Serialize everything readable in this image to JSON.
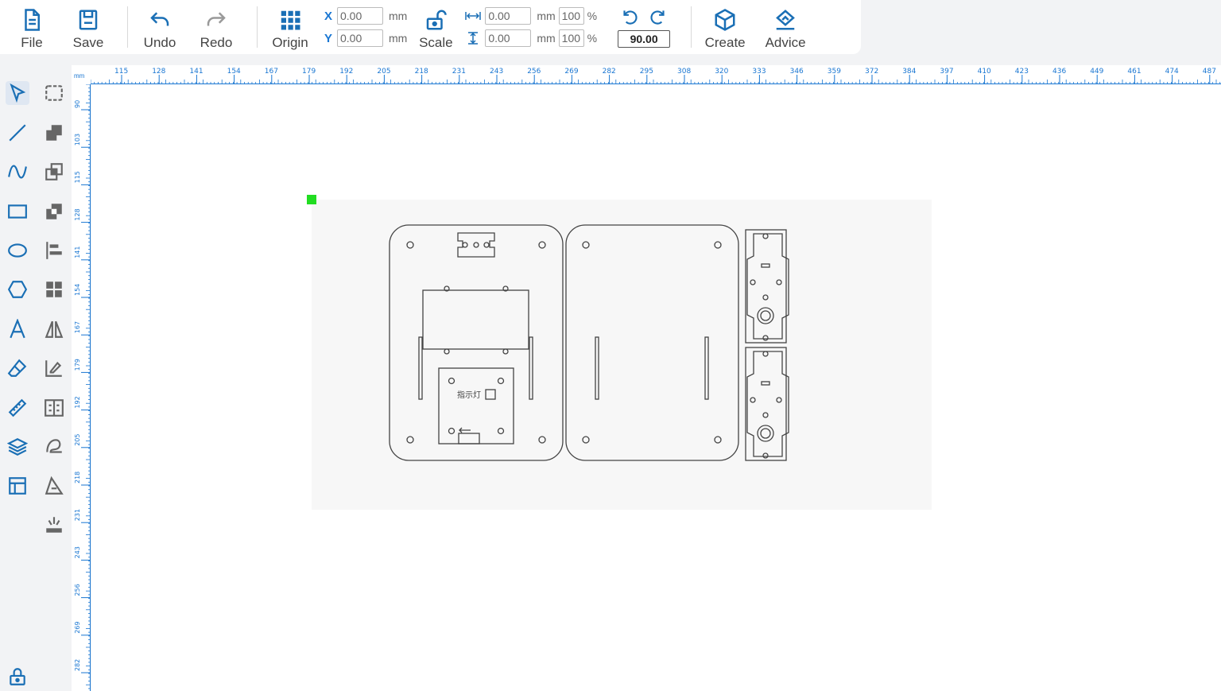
{
  "toolbar": {
    "file_label": "File",
    "save_label": "Save",
    "undo_label": "Undo",
    "redo_label": "Redo",
    "origin_label": "Origin",
    "scale_label": "Scale",
    "create_label": "Create",
    "advice_label": "Advice",
    "x_axis": "X",
    "y_axis": "Y",
    "x_value": "0.00",
    "y_value": "0.00",
    "width_value": "0.00",
    "height_value": "0.00",
    "width_pct": "100",
    "height_pct": "100",
    "unit": "mm",
    "pct_symbol": "%",
    "rotation_value": "90.00"
  },
  "ruler": {
    "unit": "mm",
    "top_ticks": [
      "115",
      "128",
      "141",
      "154",
      "167",
      "179",
      "192",
      "205",
      "218",
      "231",
      "243",
      "256",
      "269",
      "282",
      "295",
      "308",
      "320",
      "333",
      "346",
      "359",
      "372",
      "384",
      "397",
      "410",
      "423",
      "436",
      "449",
      "461",
      "474",
      "487"
    ],
    "left_ticks": [
      "90",
      "103",
      "115",
      "128",
      "141",
      "154",
      "167",
      "179",
      "192",
      "205",
      "218",
      "231",
      "243",
      "256",
      "269",
      "282"
    ]
  },
  "canvas": {
    "indicator_label": "指示灯"
  },
  "colors": {
    "accent": "#1976d2",
    "origin_marker": "#22dd22",
    "icon": "#1a6fb5"
  },
  "tools": {
    "left_column": [
      "select-arrow-icon",
      "line-icon",
      "curve-icon",
      "rectangle-icon",
      "ellipse-icon",
      "polygon-icon",
      "text-icon",
      "eraser-icon",
      "ruler-icon",
      "layers-icon",
      "layout-icon",
      "lock-icon"
    ],
    "right_column": [
      "node-edit-icon",
      "union-icon",
      "intersect-icon",
      "subtract-icon",
      "align-left-icon",
      "arrange-grid-icon",
      "mirror-icon",
      "sign-icon",
      "distribute-icon",
      "trace-image-icon",
      "trace-outline-icon",
      "laser-icon"
    ]
  }
}
